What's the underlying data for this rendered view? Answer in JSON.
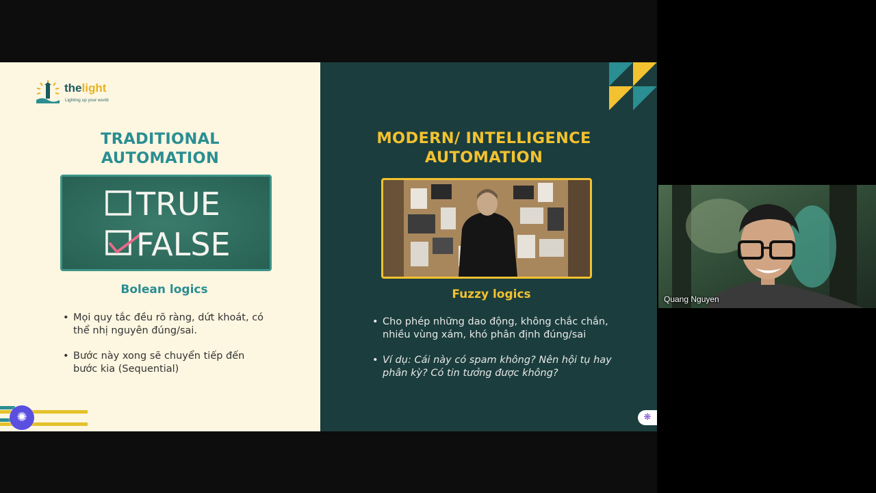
{
  "meeting": {
    "participant": {
      "name": "Quang Nguyen"
    }
  },
  "slide": {
    "logo": {
      "brand_the": "the",
      "brand_light": "light",
      "tagline": "Lighting up your world"
    },
    "left": {
      "title_line1": "TRADITIONAL",
      "title_line2": "AUTOMATION",
      "chalkboard": {
        "option_true": "TRUE",
        "option_false": "FALSE",
        "checked": "FALSE"
      },
      "subtitle": "Bolean logics",
      "bullets": [
        "Mọi quy tắc đều rõ ràng, dứt khoát, có thể nhị nguyên đúng/sai.",
        "Bước này xong sẽ chuyển tiếp đến bước kia (Sequential)"
      ]
    },
    "right": {
      "title_line1": "MODERN/ INTELLIGENCE",
      "title_line2": "AUTOMATION",
      "subtitle": "Fuzzy logics",
      "bullets": [
        "Cho phép những dao động, không chắc chắn, nhiều vùng xám, khó phân định đúng/sai",
        "Ví dụ: Cái này có spam không? Nên hội tụ hay phân kỳ? Có tin tưởng được không?"
      ]
    }
  },
  "icons": {
    "launcher": "sparkle-icon",
    "assistant": "brain-icon"
  },
  "colors": {
    "teal": "#2a8e92",
    "gold": "#f2c230",
    "dark_panel": "#1b3d3d",
    "cream_panel": "#fdf6e1",
    "launcher": "#5b4fe0"
  }
}
